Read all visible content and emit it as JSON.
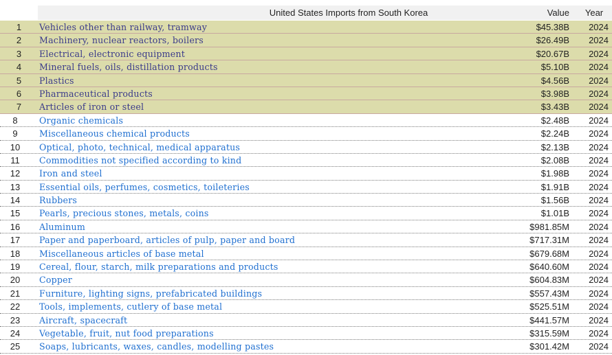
{
  "table": {
    "title": "United States Imports from South Korea",
    "value_header": "Value",
    "year_header": "Year",
    "rows": [
      {
        "rank": "1",
        "name": "Vehicles other than railway, tramway",
        "value": "$45.38B",
        "year": "2024",
        "highlight": true
      },
      {
        "rank": "2",
        "name": "Machinery, nuclear reactors, boilers",
        "value": "$26.49B",
        "year": "2024",
        "highlight": true
      },
      {
        "rank": "3",
        "name": "Electrical, electronic equipment",
        "value": "$20.67B",
        "year": "2024",
        "highlight": true
      },
      {
        "rank": "4",
        "name": "Mineral fuels, oils, distillation products",
        "value": "$5.10B",
        "year": "2024",
        "highlight": true
      },
      {
        "rank": "5",
        "name": "Plastics",
        "value": "$4.56B",
        "year": "2024",
        "highlight": true
      },
      {
        "rank": "6",
        "name": "Pharmaceutical products",
        "value": "$3.98B",
        "year": "2024",
        "highlight": true
      },
      {
        "rank": "7",
        "name": "Articles of iron or steel",
        "value": "$3.43B",
        "year": "2024",
        "highlight": true
      },
      {
        "rank": "8",
        "name": "Organic chemicals",
        "value": "$2.48B",
        "year": "2024",
        "highlight": false
      },
      {
        "rank": "9",
        "name": "Miscellaneous chemical products",
        "value": "$2.24B",
        "year": "2024",
        "highlight": false
      },
      {
        "rank": "10",
        "name": "Optical, photo, technical, medical apparatus",
        "value": "$2.13B",
        "year": "2024",
        "highlight": false
      },
      {
        "rank": "11",
        "name": "Commodities not specified according to kind",
        "value": "$2.08B",
        "year": "2024",
        "highlight": false
      },
      {
        "rank": "12",
        "name": "Iron and steel",
        "value": "$1.98B",
        "year": "2024",
        "highlight": false
      },
      {
        "rank": "13",
        "name": "Essential oils, perfumes, cosmetics, toileteries",
        "value": "$1.91B",
        "year": "2024",
        "highlight": false
      },
      {
        "rank": "14",
        "name": "Rubbers",
        "value": "$1.56B",
        "year": "2024",
        "highlight": false
      },
      {
        "rank": "15",
        "name": "Pearls, precious stones, metals, coins",
        "value": "$1.01B",
        "year": "2024",
        "highlight": false
      },
      {
        "rank": "16",
        "name": "Aluminum",
        "value": "$981.85M",
        "year": "2024",
        "highlight": false
      },
      {
        "rank": "17",
        "name": "Paper and paperboard, articles of pulp, paper and board",
        "value": "$717.31M",
        "year": "2024",
        "highlight": false
      },
      {
        "rank": "18",
        "name": "Miscellaneous articles of base metal",
        "value": "$679.68M",
        "year": "2024",
        "highlight": false
      },
      {
        "rank": "19",
        "name": "Cereal, flour, starch, milk preparations and products",
        "value": "$640.60M",
        "year": "2024",
        "highlight": false
      },
      {
        "rank": "20",
        "name": "Copper",
        "value": "$604.83M",
        "year": "2024",
        "highlight": false
      },
      {
        "rank": "21",
        "name": "Furniture, lighting signs, prefabricated buildings",
        "value": "$557.43M",
        "year": "2024",
        "highlight": false
      },
      {
        "rank": "22",
        "name": "Tools, implements, cutlery of base metal",
        "value": "$525.51M",
        "year": "2024",
        "highlight": false
      },
      {
        "rank": "23",
        "name": "Aircraft, spacecraft",
        "value": "$441.57M",
        "year": "2024",
        "highlight": false
      },
      {
        "rank": "24",
        "name": "Vegetable, fruit, nut food preparations",
        "value": "$315.59M",
        "year": "2024",
        "highlight": false
      },
      {
        "rank": "25",
        "name": "Soaps, lubricants, waxes, candles, modelling pastes",
        "value": "$301.42M",
        "year": "2024",
        "highlight": false
      }
    ]
  },
  "colors": {
    "highlight_bg": "#dcdcab",
    "link": "#1f6fd0",
    "highlight_link": "#3a3a8a"
  }
}
